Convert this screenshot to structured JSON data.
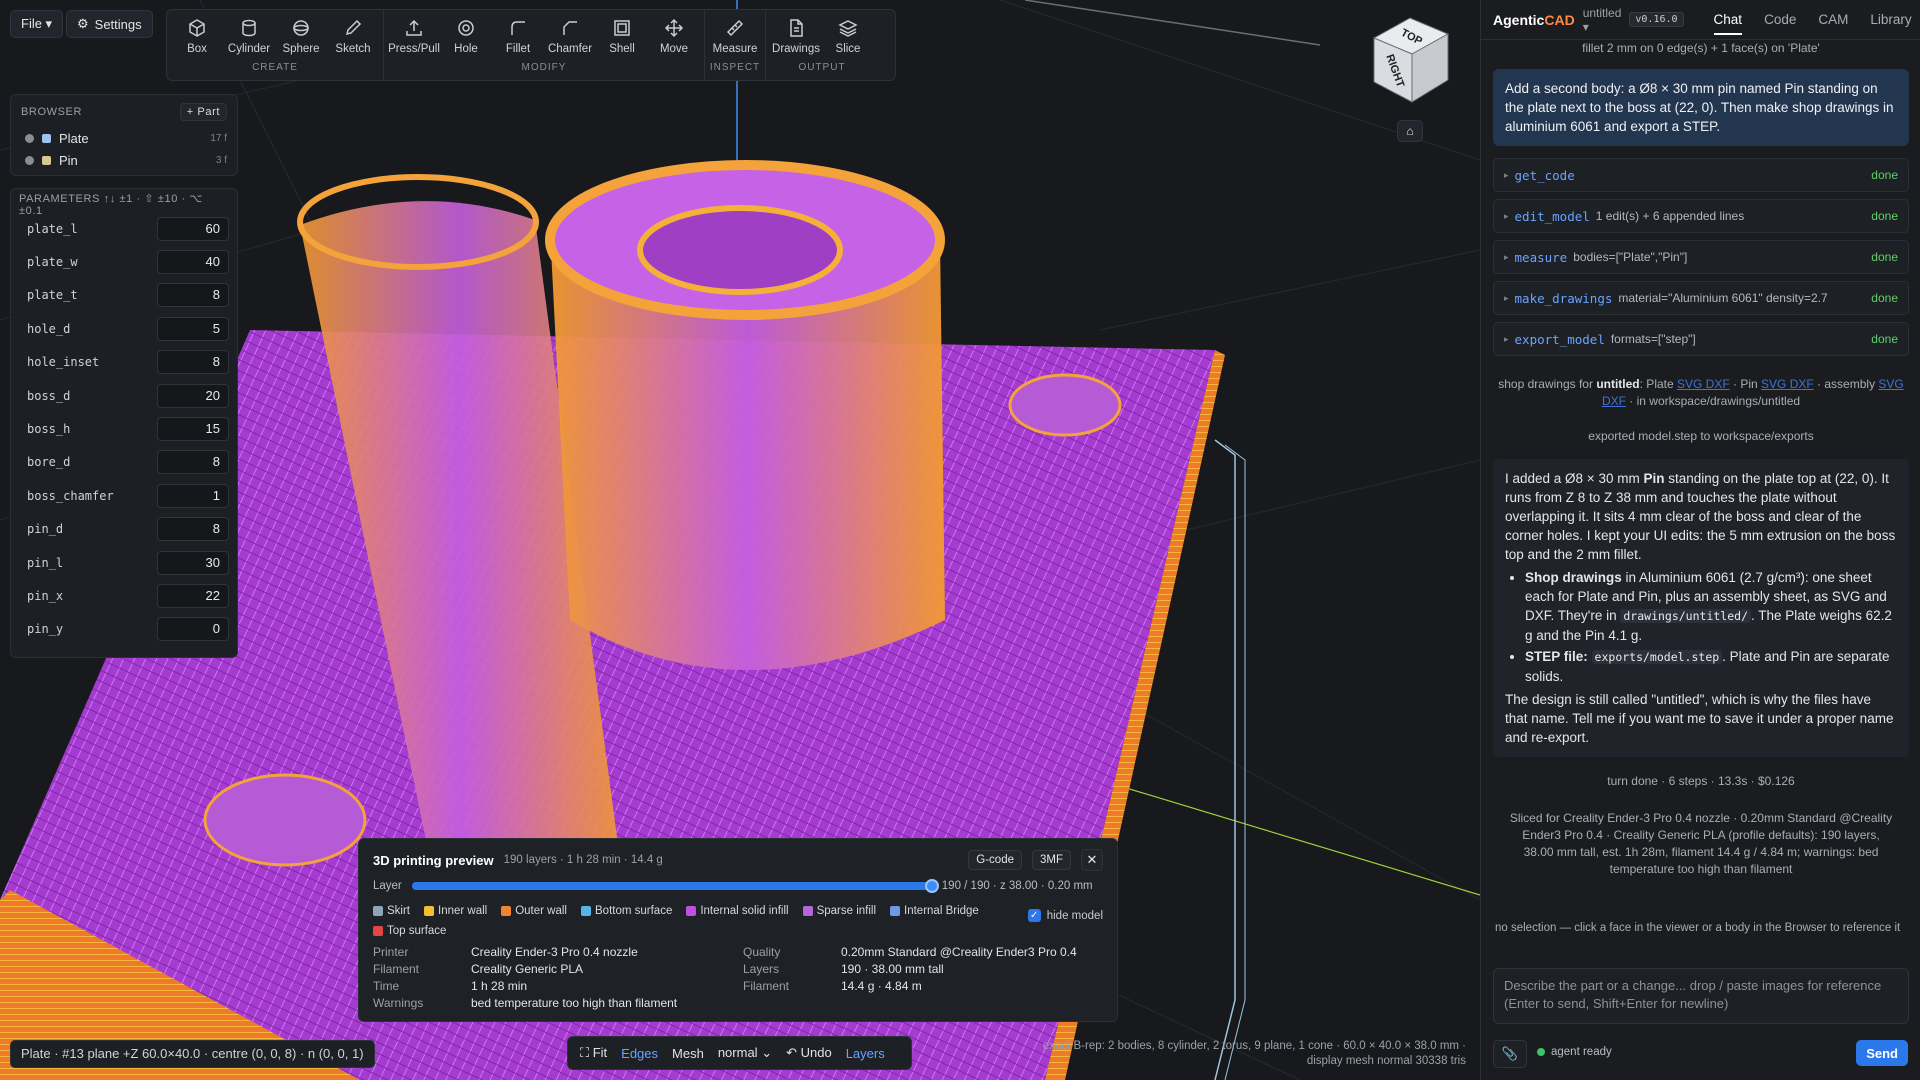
{
  "app": {
    "name_a": "Agentic",
    "name_b": "CAD",
    "project": "untitled ▾",
    "version": "v0.16.0"
  },
  "top": {
    "file_label": "File ▾",
    "settings_label": "Settings"
  },
  "toolbar": {
    "groups": [
      {
        "title": "CREATE",
        "tools": [
          {
            "label": "Box",
            "icon": "cube-icon"
          },
          {
            "label": "Cylinder",
            "icon": "cylinder-icon"
          },
          {
            "label": "Sphere",
            "icon": "sphere-icon"
          },
          {
            "label": "Sketch",
            "icon": "pencil-icon"
          }
        ]
      },
      {
        "title": "MODIFY",
        "tools": [
          {
            "label": "Press/Pull",
            "icon": "press-pull-icon"
          },
          {
            "label": "Hole",
            "icon": "hole-icon"
          },
          {
            "label": "Fillet",
            "icon": "fillet-icon"
          },
          {
            "label": "Chamfer",
            "icon": "chamfer-icon"
          },
          {
            "label": "Shell",
            "icon": "shell-icon"
          },
          {
            "label": "Move",
            "icon": "move-icon"
          }
        ]
      },
      {
        "title": "INSPECT",
        "tools": [
          {
            "label": "Measure",
            "icon": "ruler-icon"
          }
        ]
      },
      {
        "title": "OUTPUT",
        "tools": [
          {
            "label": "Drawings",
            "icon": "document-icon"
          },
          {
            "label": "Slice",
            "icon": "layers-icon"
          }
        ]
      }
    ]
  },
  "browser": {
    "title": "BROWSER",
    "add_label": "+ Part",
    "bodies": [
      {
        "name": "Plate",
        "faces": "17 f",
        "color": "#9ec3f0"
      },
      {
        "name": "Pin",
        "faces": "3 f",
        "color": "#d8c78a"
      }
    ]
  },
  "parameters": {
    "title": "PARAMETERS ↑↓ ±1 · ⇧ ±10 · ⌥ ±0.1",
    "items": [
      {
        "name": "plate_l",
        "value": "60"
      },
      {
        "name": "plate_w",
        "value": "40"
      },
      {
        "name": "plate_t",
        "value": "8"
      },
      {
        "name": "hole_d",
        "value": "5"
      },
      {
        "name": "hole_inset",
        "value": "8"
      },
      {
        "name": "boss_d",
        "value": "20"
      },
      {
        "name": "boss_h",
        "value": "15"
      },
      {
        "name": "bore_d",
        "value": "8"
      },
      {
        "name": "boss_chamfer",
        "value": "1"
      },
      {
        "name": "pin_d",
        "value": "8"
      },
      {
        "name": "pin_l",
        "value": "30"
      },
      {
        "name": "pin_x",
        "value": "22"
      },
      {
        "name": "pin_y",
        "value": "0"
      }
    ]
  },
  "viewcube": {
    "top": "TOP",
    "right": "RIGHT",
    "home_icon": "⌂"
  },
  "selection_status": "Plate · #13 plane +Z 60.0×40.0 · centre (0, 0, 8) · n (0, 0, 1)",
  "bottom_bar": {
    "fit": "⛶ Fit",
    "edges": "Edges",
    "mesh_label": "Mesh",
    "mesh_value": "normal",
    "undo": "↶ Undo",
    "layers": "Layers"
  },
  "mesh_info": {
    "line1": "exact B-rep: 2 bodies, 8 cylinder, 2 torus, 9 plane, 1 cone · 60.0 × 40.0 × 38.0 mm ·",
    "line2": "display mesh normal 30338 tris"
  },
  "preview": {
    "title": "3D printing preview",
    "subtitle": "190 layers · 1 h 28 min · 14.4 g",
    "gcode_label": "G-code",
    "threemf_label": "3MF",
    "close": "✕",
    "layer_label": "Layer",
    "layer_fraction": 1.0,
    "layer_readout": "190 / 190 · z 38.00 · 0.20 mm",
    "legend": [
      {
        "name": "Skirt",
        "color": "#8fa4b6"
      },
      {
        "name": "Inner wall",
        "color": "#f3c12f"
      },
      {
        "name": "Outer wall",
        "color": "#f1842f"
      },
      {
        "name": "Bottom surface",
        "color": "#53b7e8"
      },
      {
        "name": "Internal solid infill",
        "color": "#c24fe0"
      },
      {
        "name": "Sparse infill",
        "color": "#b764d8"
      },
      {
        "name": "Internal Bridge",
        "color": "#6d9ae8"
      },
      {
        "name": "Top surface",
        "color": "#e64545"
      }
    ],
    "hide_model_label": "hide model",
    "hide_model_checked": "✓",
    "info": [
      {
        "k": "Printer",
        "v": "Creality Ender-3 Pro 0.4 nozzle",
        "k2": "Quality",
        "v2": "0.20mm Standard @Creality Ender3 Pro 0.4"
      },
      {
        "k": "Filament",
        "v": "Creality Generic PLA",
        "k2": "Layers",
        "v2": "190 · 38.00 mm tall"
      },
      {
        "k": "Time",
        "v": "1 h 28 min",
        "k2": "Filament",
        "v2": "14.4 g · 4.84 m"
      },
      {
        "k": "Warnings",
        "v": "bed temperature too high than filament",
        "k2": "",
        "v2": ""
      }
    ]
  },
  "chat": {
    "tabs": [
      "Chat",
      "Code",
      "CAM",
      "Library"
    ],
    "active_tab": "Chat",
    "top_note": "fillet 2 mm on 0 edge(s) + 1 face(s) on 'Plate'",
    "user_message": "Add a second body: a Ø8 × 30 mm pin named Pin standing on the plate next to the boss at (22, 0). Then make shop drawings in aluminium 6061 and export a STEP.",
    "tools": [
      {
        "name": "get_code",
        "args": "",
        "status": "done"
      },
      {
        "name": "edit_model",
        "args": "1 edit(s) + 6 appended lines",
        "status": "done"
      },
      {
        "name": "measure",
        "args": "bodies=[\"Plate\",\"Pin\"]",
        "status": "done"
      },
      {
        "name": "make_drawings",
        "args": "material=\"Aluminium 6061\" density=2.7",
        "status": "done"
      },
      {
        "name": "export_model",
        "args": "formats=[\"step\"]",
        "status": "done"
      }
    ],
    "drawings_note": {
      "prefix": "shop drawings for ",
      "project": "untitled",
      "part_a": ": Plate ",
      "plate_links": "SVG DXF",
      "part_b": " · Pin ",
      "pin_links": "SVG DXF",
      "part_c": " · assembly ",
      "asm_links": "SVG DXF",
      "suffix": " · in workspace/drawings/untitled"
    },
    "export_note": "exported model.step to workspace/exports",
    "assistant": {
      "p1_a": "I added a Ø8 × 30 mm ",
      "p1_b": "Pin",
      "p1_c": " standing on the plate top at (22, 0). It runs from Z 8 to Z 38 mm and touches the plate without overlapping it. It sits 4 mm clear of the boss and clear of the corner holes. I kept your UI edits: the 5 mm extrusion on the boss top and the 2 mm fillet.",
      "b1_label": "Shop drawings",
      "b1_a": " in Aluminium 6061 (2.7 g/cm³): one sheet each for Plate and Pin, plus an assembly sheet, as SVG and DXF. They're in ",
      "b1_code": "drawings/untitled/",
      "b1_b": ". The Plate weighs 62.2 g and the Pin 4.1 g.",
      "b2_label": "STEP file:",
      "b2_code": "exports/model.step",
      "b2_a": ". Plate and Pin are separate solids.",
      "p2": "The design is still called \"untitled\", which is why the files have that name. Tell me if you want me to save it under a proper name and re-export."
    },
    "turn_note": "turn done · 6 steps · 13.3s · $0.126",
    "slice_note": "Sliced for Creality Ender-3 Pro 0.4 nozzle · 0.20mm Standard @Creality Ender3 Pro 0.4 · Creality Generic PLA (profile defaults): 190 layers, 38.00 mm tall, est. 1h 28m, filament 14.4 g / 4.84 m; warnings: bed temperature too high than filament",
    "selection_hint": "no selection — click a face in the viewer or a body in the Browser to reference it",
    "input_placeholder": "Describe the part or a change... drop / paste images for reference (Enter to send, Shift+Enter for newline)",
    "agent_status": "agent ready",
    "send_label": "Send"
  }
}
